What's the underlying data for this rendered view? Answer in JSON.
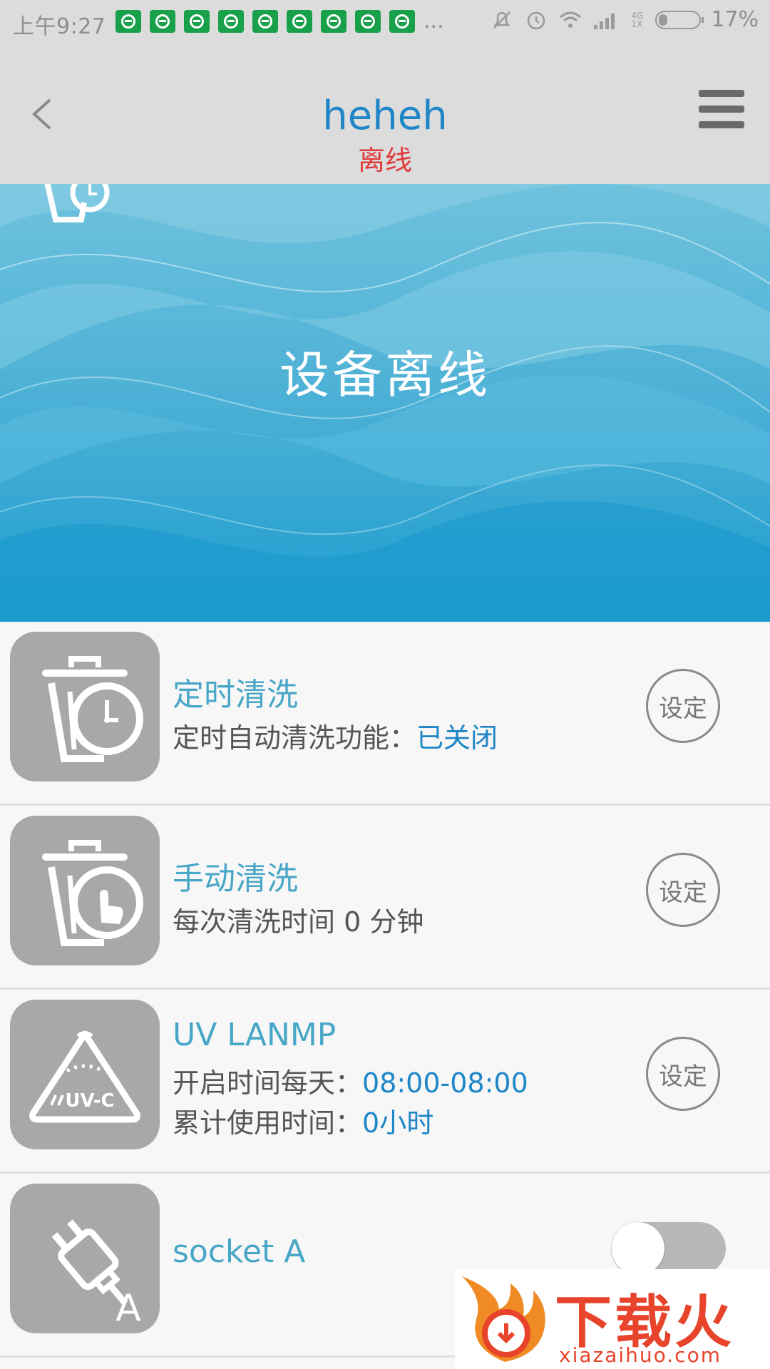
{
  "status_bar": {
    "time": "上午9:27",
    "notification_count": 9,
    "more": "...",
    "battery": "17%",
    "network": "4G 1X"
  },
  "header": {
    "title": "heheh",
    "status": "离线"
  },
  "banner": {
    "message": "设备离线"
  },
  "rows": [
    {
      "title": "定时清洗",
      "line1_label": "定时自动清洗功能：",
      "line1_value": "已关闭",
      "button": "设定",
      "icon": "timer-clean-icon"
    },
    {
      "title": "手动清洗",
      "line1_label": "每次清洗时间 0 分钟",
      "button": "设定",
      "icon": "manual-clean-icon"
    },
    {
      "title": "UV LANMP",
      "line1_label": "开启时间每天：",
      "line1_value": "08:00-08:00",
      "line2_label": "累计使用时间：",
      "line2_value": "0小时",
      "button": "设定",
      "icon": "uv-lamp-icon",
      "icon_text": "UV-C"
    },
    {
      "title": "socket A",
      "toggle_on": false,
      "icon": "socket-plug-icon",
      "icon_letter": "A"
    }
  ],
  "watermark": {
    "text": "下载火",
    "url": "xiazaihuo.com"
  },
  "colors": {
    "accent": "#1f86c7",
    "title_teal": "#48a6c7",
    "offline_red": "#e03a3a",
    "header_bg": "#dcdcdc"
  }
}
